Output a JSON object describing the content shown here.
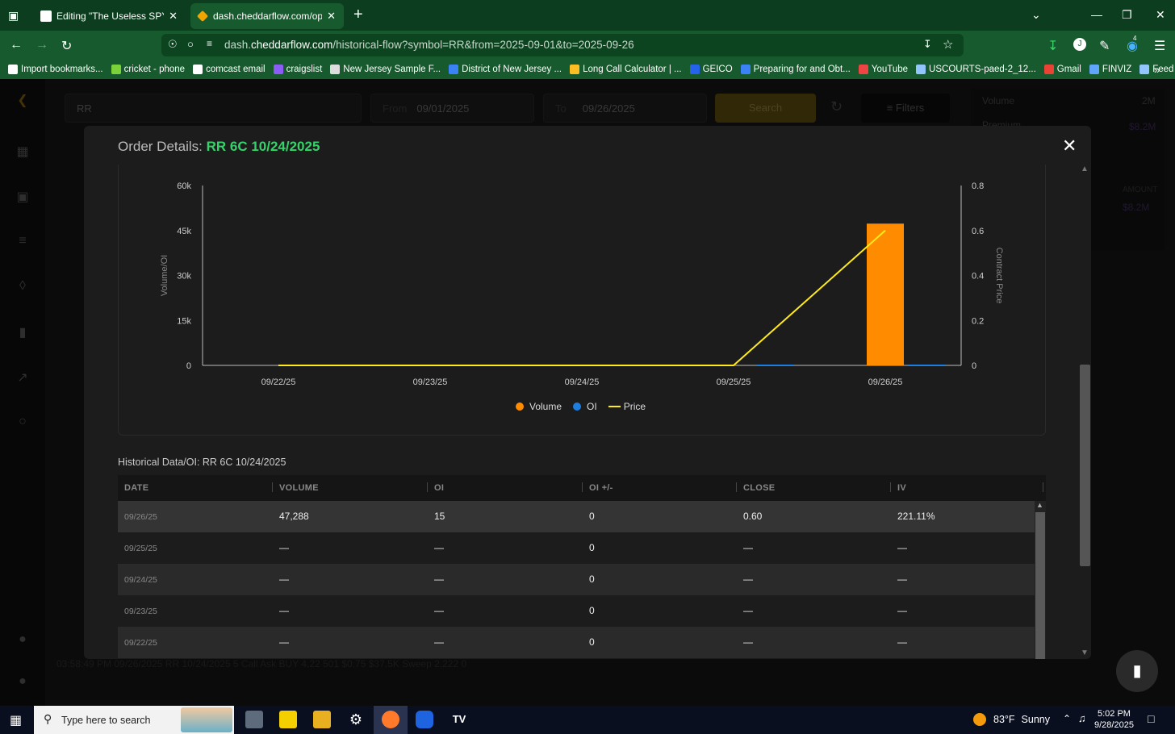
{
  "browser": {
    "tabs": [
      {
        "title": "Editing \"The Useless SPY Report\"",
        "active": false
      },
      {
        "title": "dash.cheddarflow.com/options-",
        "active": true
      }
    ],
    "url_prefix": "dash.",
    "url_domain": "cheddarflow.com",
    "url_path": "/historical-flow?symbol=RR&from=2025-09-01&to=2025-09-26",
    "bookmarks": [
      "Import bookmarks...",
      "cricket - phone",
      "comcast email",
      "craigslist",
      "New Jersey Sample F...",
      "District of New Jersey ...",
      "Long Call Calculator | ...",
      "GEICO",
      "Preparing for and Obt...",
      "YouTube",
      "USCOURTS-paed-2_12...",
      "Gmail",
      "FINVIZ",
      "Feed | Utradea"
    ],
    "extension_badge": "4"
  },
  "app": {
    "search_value": "RR",
    "from_label": "From",
    "from_value": "09/01/2025",
    "to_label": "To",
    "to_value": "09/26/2025",
    "search_button": "Search",
    "filters_button": "Filters",
    "side_stats": {
      "volume_label": "Volume",
      "volume_value": "2M",
      "premium_label": "Premium",
      "premium_value": "$8.2M",
      "amount_label": "AMOUNT",
      "amount_value": "$8.2M"
    },
    "background_rows": [
      "03:58:49 PM    09/26/2025    RR    10/24/2025    5    Call    Ask    BUY    4.22    501    $0.75    $37.5K    Sweep    2,222    0"
    ]
  },
  "modal": {
    "title_label": "Order Details:",
    "title_symbol": "RR 6C 10/24/2025",
    "close": "✕",
    "history_title": "Historical Data/OI: RR 6C 10/24/2025",
    "columns": [
      "DATE",
      "VOLUME",
      "OI",
      "OI +/-",
      "CLOSE",
      "IV"
    ],
    "rows": [
      [
        "09/26/25",
        "47,288",
        "15",
        "0",
        "0.60",
        "221.11%"
      ],
      [
        "09/25/25",
        "—",
        "—",
        "0",
        "—",
        "—"
      ],
      [
        "09/24/25",
        "—",
        "—",
        "0",
        "—",
        "—"
      ],
      [
        "09/23/25",
        "—",
        "—",
        "0",
        "—",
        "—"
      ],
      [
        "09/22/25",
        "—",
        "—",
        "0",
        "—",
        "—"
      ]
    ]
  },
  "chart_data": {
    "type": "bar",
    "categories": [
      "09/22/25",
      "09/23/25",
      "09/24/25",
      "09/25/25",
      "09/26/25"
    ],
    "series": [
      {
        "name": "Volume",
        "axis": "left",
        "kind": "bar",
        "color": "#ff8c00",
        "values": [
          0,
          0,
          0,
          0,
          47288
        ]
      },
      {
        "name": "OI",
        "axis": "left",
        "kind": "bar",
        "color": "#1e7ee0",
        "values": [
          0,
          0,
          0,
          0,
          15
        ]
      },
      {
        "name": "Price",
        "axis": "right",
        "kind": "line",
        "color": "#ffeb1a",
        "values": [
          0,
          0,
          0,
          0,
          0.6
        ]
      }
    ],
    "ylabel": "Volume/OI",
    "y2label": "Contract Price",
    "ylim": [
      0,
      60000
    ],
    "y2lim": [
      0,
      0.8
    ],
    "yticks": [
      "0",
      "15k",
      "30k",
      "45k",
      "60k"
    ],
    "y2ticks": [
      "0",
      "0.2",
      "0.4",
      "0.6",
      "0.8"
    ],
    "legend": "bottom-center",
    "grid": false
  },
  "taskbar": {
    "search_placeholder": "Type here to search",
    "weather_temp": "83°F",
    "weather_text": "Sunny",
    "time": "5:02 PM",
    "date": "9/28/2025"
  },
  "colors": {
    "accent_green": "#34d36a",
    "volume": "#ff8c00",
    "oi": "#1e7ee0",
    "price": "#ffeb1a"
  }
}
